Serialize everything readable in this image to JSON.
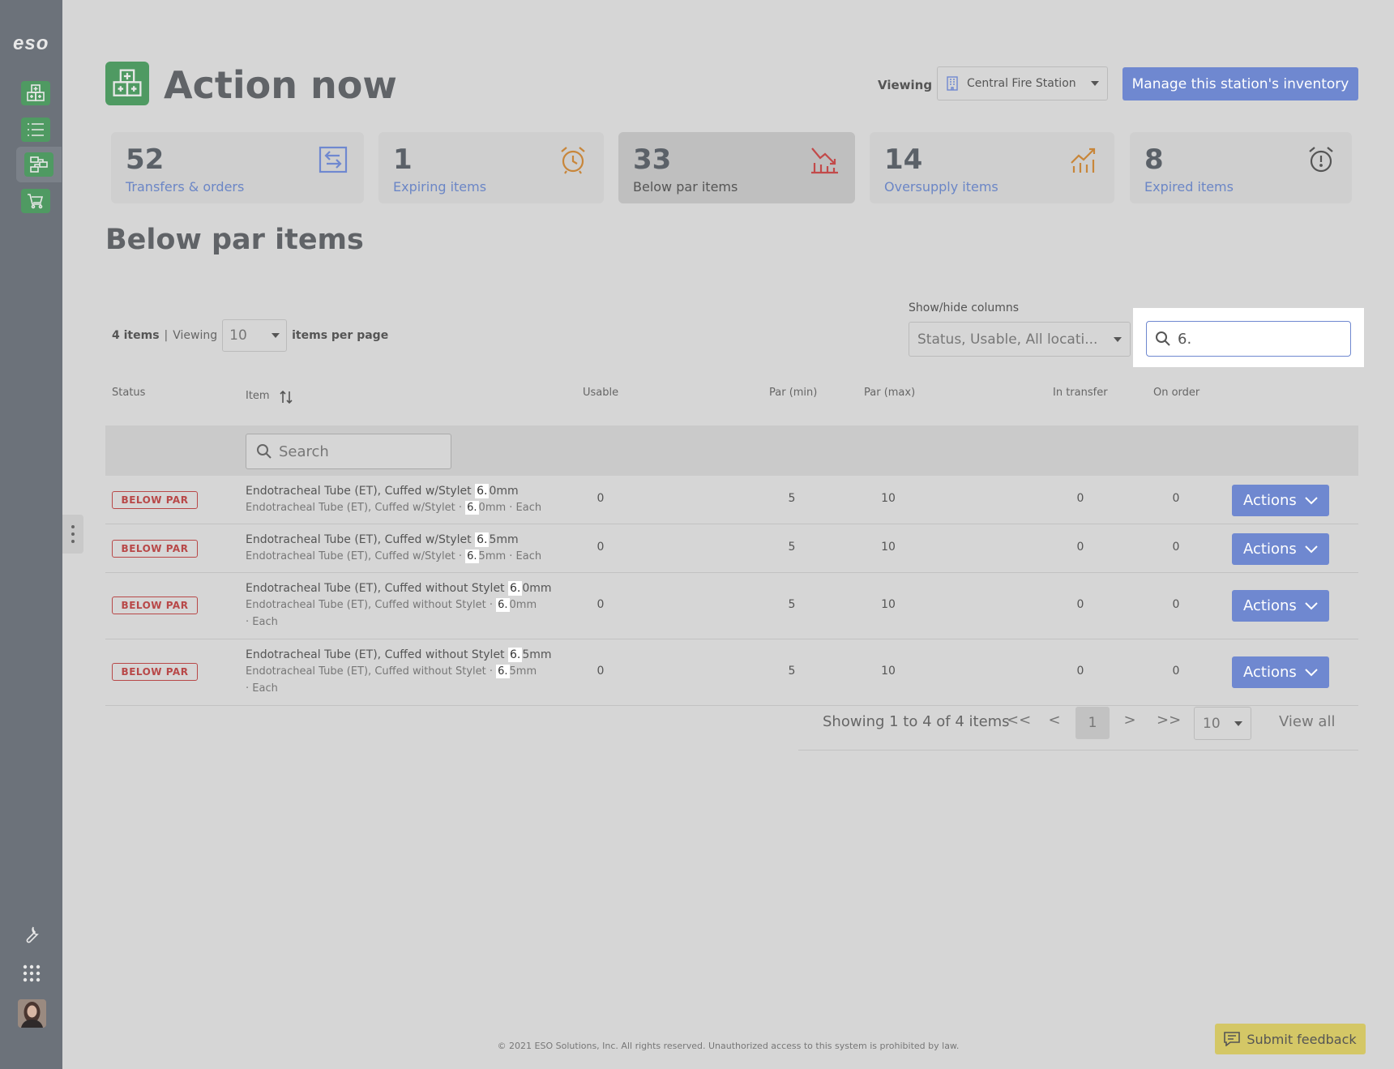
{
  "app": {
    "logo_text": "eso",
    "page_title": "Action now"
  },
  "header": {
    "viewing_label": "Viewing",
    "station": "Central Fire Station",
    "manage_button": "Manage this station's inventory"
  },
  "summary_cards": [
    {
      "count": "52",
      "label": "Transfers & orders",
      "icon": "transfer-icon"
    },
    {
      "count": "1",
      "label": "Expiring items",
      "icon": "alarm-clock-icon"
    },
    {
      "count": "33",
      "label": "Below par items",
      "icon": "trend-down-icon"
    },
    {
      "count": "14",
      "label": "Oversupply items",
      "icon": "trend-up-icon"
    },
    {
      "count": "8",
      "label": "Expired items",
      "icon": "alarm-alert-icon"
    }
  ],
  "section": {
    "title": "Below par items"
  },
  "list_controls": {
    "item_count": "4 items",
    "separator": "|",
    "viewing": "Viewing",
    "per_page_value": "10",
    "per_page_suffix": "items per page",
    "show_hide_label": "Show/hide columns",
    "show_hide_value": "Status, Usable, All locati...",
    "search_value": "6."
  },
  "table": {
    "columns": {
      "status": "Status",
      "item": "Item",
      "usable": "Usable",
      "par_min": "Par (min)",
      "par_max": "Par (max)",
      "in_transfer": "In transfer",
      "on_order": "On order"
    },
    "item_search_placeholder": "Search",
    "rows": [
      {
        "status": "BELOW PAR",
        "name_pre": "Endotracheal Tube (ET), Cuffed w/Stylet ",
        "name_hl": "6.",
        "name_post": "0mm",
        "sub_pre": "Endotracheal Tube (ET), Cuffed w/Stylet · ",
        "sub_hl": "6.",
        "sub_post": "0mm · Each",
        "usable": "0",
        "par_min": "5",
        "par_max": "10",
        "in_transfer": "0",
        "on_order": "0",
        "action": "Actions"
      },
      {
        "status": "BELOW PAR",
        "name_pre": "Endotracheal Tube (ET), Cuffed w/Stylet ",
        "name_hl": "6.",
        "name_post": "5mm",
        "sub_pre": "Endotracheal Tube (ET), Cuffed w/Stylet · ",
        "sub_hl": "6.",
        "sub_post": "5mm · Each",
        "usable": "0",
        "par_min": "5",
        "par_max": "10",
        "in_transfer": "0",
        "on_order": "0",
        "action": "Actions"
      },
      {
        "status": "BELOW PAR",
        "name_pre": "Endotracheal Tube (ET), Cuffed without Stylet ",
        "name_hl": "6.",
        "name_post": "0mm",
        "sub_pre": "Endotracheal Tube (ET), Cuffed without Stylet · ",
        "sub_hl": "6.",
        "sub_post": "0mm · Each",
        "usable": "0",
        "par_min": "5",
        "par_max": "10",
        "in_transfer": "0",
        "on_order": "0",
        "action": "Actions"
      },
      {
        "status": "BELOW PAR",
        "name_pre": "Endotracheal Tube (ET), Cuffed without Stylet ",
        "name_hl": "6.",
        "name_post": "5mm",
        "sub_pre": "Endotracheal Tube (ET), Cuffed without Stylet · ",
        "sub_hl": "6.",
        "sub_post": "5mm · Each",
        "usable": "0",
        "par_min": "5",
        "par_max": "10",
        "in_transfer": "0",
        "on_order": "0",
        "action": "Actions"
      }
    ]
  },
  "pagination": {
    "showing": "Showing 1 to 4 of 4 items",
    "first": "<<",
    "prev": "<",
    "current": "1",
    "next": ">",
    "last": ">>",
    "per_page": "10",
    "view_all": "View all"
  },
  "footer": {
    "copyright": "© 2021 ESO Solutions, Inc. All rights reserved. Unauthorized access to this system is prohibited by law.",
    "feedback": "Submit feedback"
  },
  "colors": {
    "accent_blue": "#6f88d0",
    "brand_green": "#4f9a62",
    "badge_red": "#b84848",
    "feedback_yellow": "#d4c766",
    "expiring_orange": "#c8863a",
    "below_par_red": "#c24a4a",
    "oversupply_orange": "#c8863a",
    "expired_gray": "#555555"
  }
}
